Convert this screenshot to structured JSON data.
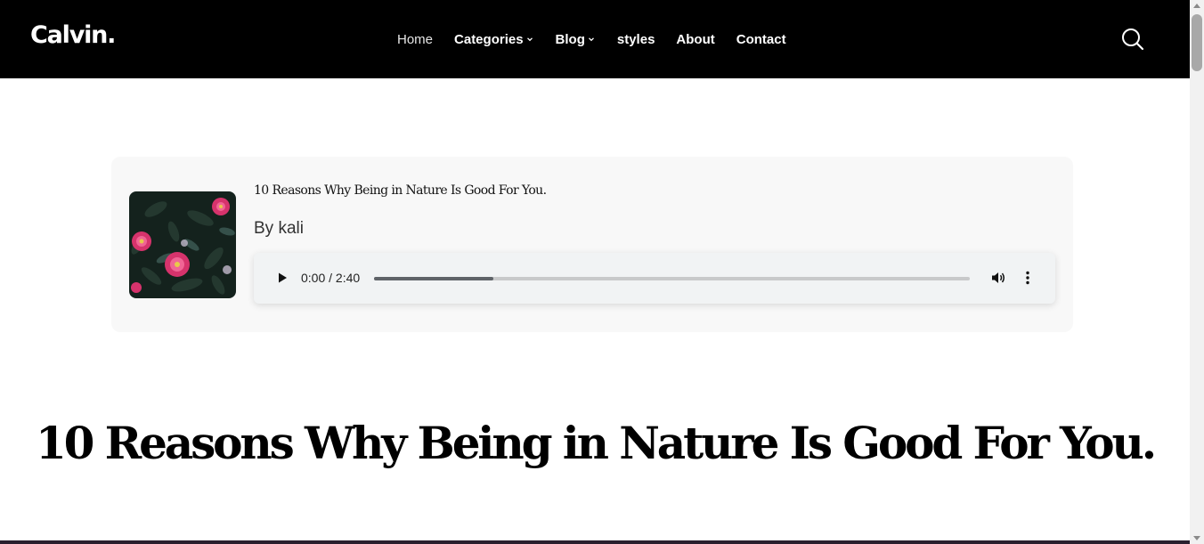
{
  "header": {
    "logo": "Calvin.",
    "nav": [
      {
        "label": "Home",
        "has_dropdown": false
      },
      {
        "label": "Categories",
        "has_dropdown": true
      },
      {
        "label": "Blog",
        "has_dropdown": true
      },
      {
        "label": "styles",
        "has_dropdown": false
      },
      {
        "label": "About",
        "has_dropdown": false
      },
      {
        "label": "Contact",
        "has_dropdown": false
      }
    ],
    "search_icon": "search-icon"
  },
  "audio": {
    "title": "10 Reasons Why Being in Nature Is Good For You.",
    "author": "By kali",
    "player": {
      "time": "0:00 / 2:40",
      "buffered_fraction": 0.2
    }
  },
  "post": {
    "title": "10 Reasons Why Being in Nature Is Good For You."
  },
  "colors": {
    "header_bg": "#000000",
    "card_bg": "#f8f8f8",
    "player_bg": "#f1f3f4",
    "flower_pink": "#d6336c"
  }
}
